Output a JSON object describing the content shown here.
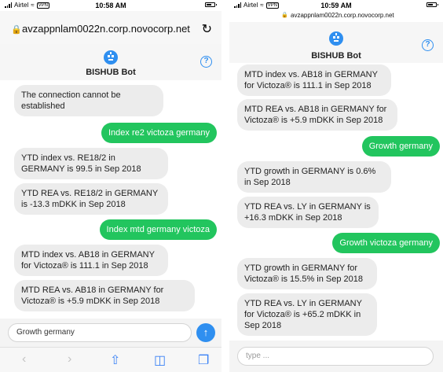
{
  "status_left": {
    "carrier": "Airtel",
    "vpn": "VPN",
    "time": "10:58 AM"
  },
  "status_right": {
    "carrier": "Airtel",
    "vpn": "VPN",
    "time": "10:59 AM"
  },
  "url_left": "avzappnlam0022n.corp.novocorp.net",
  "url_right": "avzappnlam0022n.corp.novocorp.net",
  "bot_title": "BISHUB Bot",
  "help_symbol": "?",
  "left_messages": [
    {
      "from": "bot",
      "text": "The connection cannot be established"
    },
    {
      "from": "user",
      "text": "Index re2 victoza germany"
    },
    {
      "from": "bot",
      "text": "YTD index vs. RE18/2 in GERMANY is 99.5 in Sep 2018"
    },
    {
      "from": "bot",
      "text": "YTD REA vs. RE18/2 in GERMANY is -13.3 mDKK in Sep 2018"
    },
    {
      "from": "user",
      "text": "Index mtd germany victoza"
    },
    {
      "from": "bot",
      "text": "MTD index vs. AB18 in GERMANY for Victoza® is 111.1 in Sep 2018"
    },
    {
      "from": "bot",
      "text": "MTD REA vs. AB18 in GERMANY for Victoza® is +5.9 mDKK in Sep 2018"
    }
  ],
  "right_messages": [
    {
      "from": "bot",
      "text": "MTD index vs. AB18 in GERMANY for Victoza® is 111.1 in Sep 2018"
    },
    {
      "from": "bot",
      "text": "MTD REA vs. AB18 in GERMANY for Victoza® is +5.9 mDKK in Sep 2018"
    },
    {
      "from": "user",
      "text": "Growth germany"
    },
    {
      "from": "bot",
      "text": "YTD growth in GERMANY is 0.6% in Sep 2018"
    },
    {
      "from": "bot",
      "text": "YTD REA vs. LY in GERMANY is +16.3 mDKK in Sep 2018"
    },
    {
      "from": "user",
      "text": "Growth victoza germany"
    },
    {
      "from": "bot",
      "text": "YTD growth in GERMANY for Victoza® is 15.5% in Sep 2018"
    },
    {
      "from": "bot",
      "text": "YTD REA vs. LY in GERMANY for Victoza® is +65.2 mDKK in Sep 2018"
    }
  ],
  "input_left": {
    "value": "Growth germany"
  },
  "input_right": {
    "placeholder": "type ..."
  },
  "colors": {
    "user_bubble": "#22c55e",
    "bot_bubble": "#ececec",
    "accent": "#2f8ff0"
  },
  "icons": [
    "lock-icon",
    "reload-icon",
    "bot-avatar-icon",
    "help-icon",
    "send-icon",
    "back-icon",
    "forward-icon",
    "share-icon",
    "bookmarks-icon",
    "tabs-icon"
  ]
}
